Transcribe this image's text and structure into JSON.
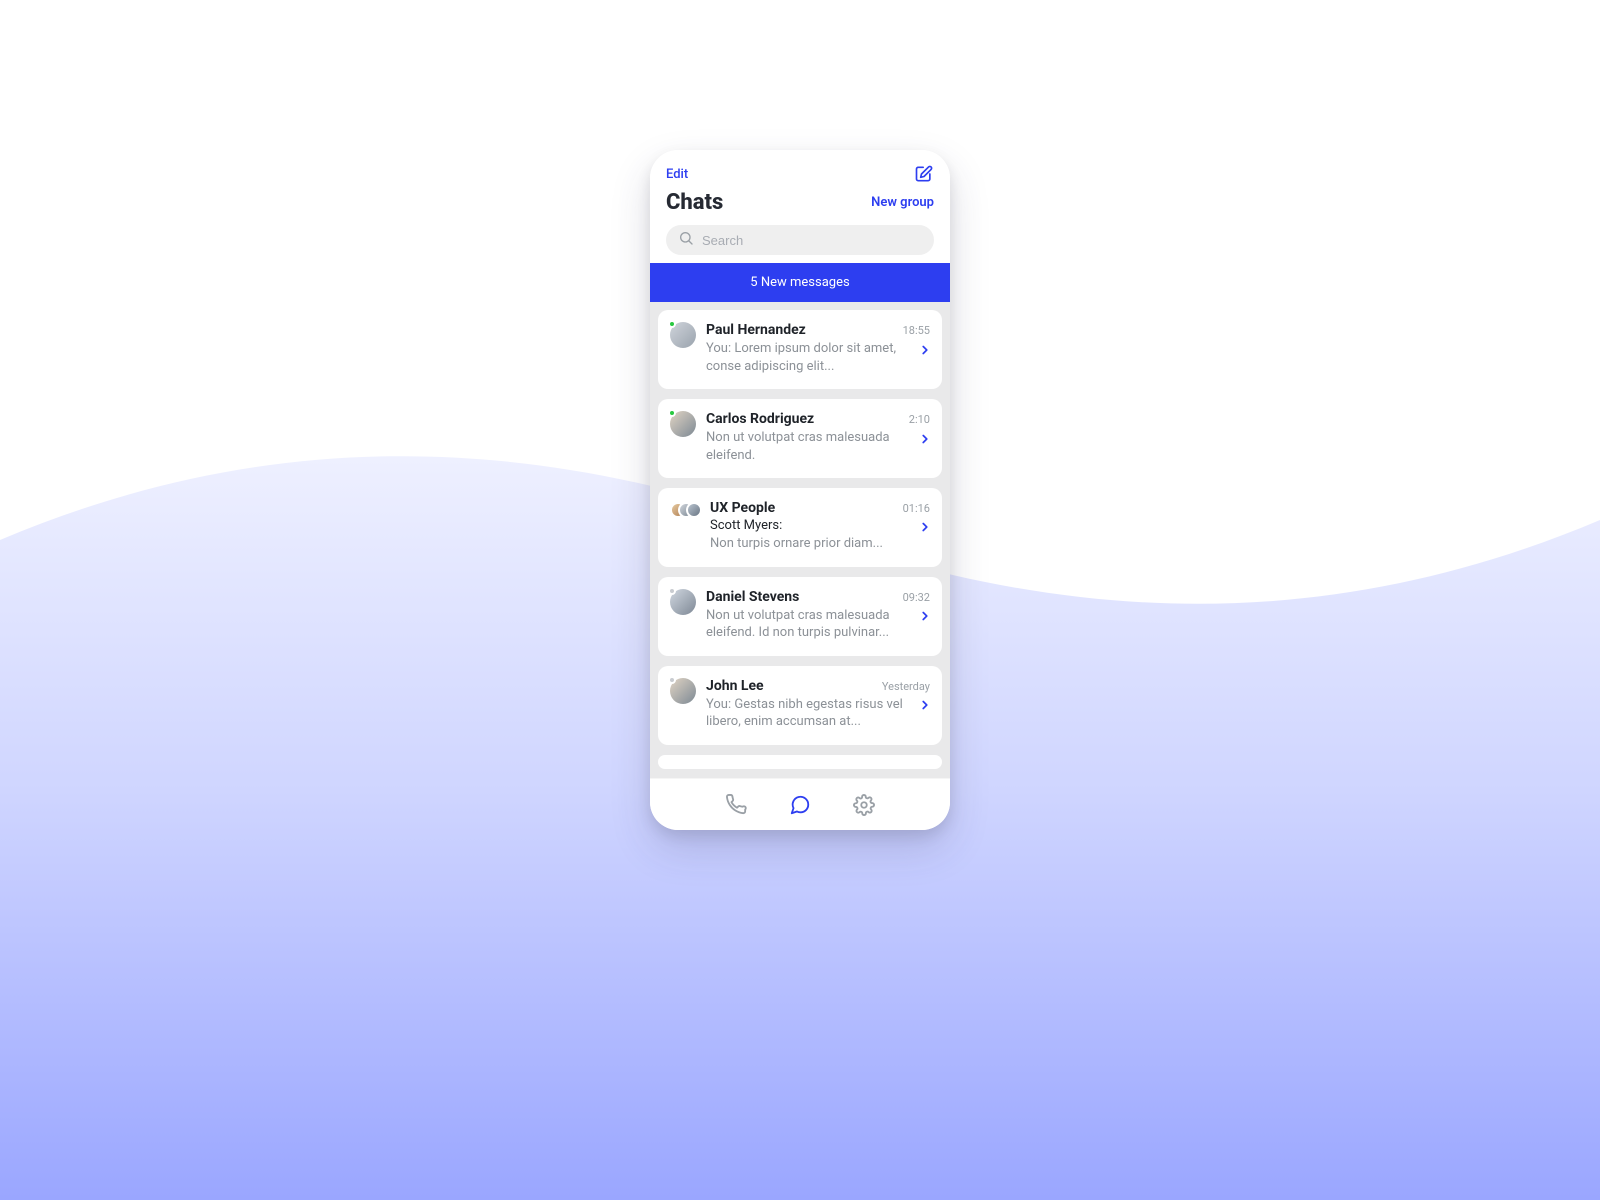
{
  "header": {
    "edit_label": "Edit",
    "title": "Chats",
    "new_group_label": "New group",
    "search_placeholder": "Search"
  },
  "banner": {
    "text": "5 New messages"
  },
  "chats": [
    {
      "name": "Paul Hernandez",
      "time": "18:55",
      "preview": "You: Lorem ipsum dolor sit amet, conse adipiscing elit...",
      "online": true
    },
    {
      "name": "Carlos Rodriguez",
      "time": "2:10",
      "preview": "Non ut volutpat cras malesuada eleifend.",
      "online": true
    },
    {
      "name": "UX People",
      "time": "01:16",
      "sender": "Scott Myers:",
      "preview": "Non turpis ornare prior diam...",
      "group": true
    },
    {
      "name": "Daniel Stevens",
      "time": "09:32",
      "preview": "Non ut volutpat cras malesuada eleifend. Id non turpis pulvinar...",
      "online": false
    },
    {
      "name": "John Lee",
      "time": "Yesterday",
      "preview": "You: Gestas nibh egestas risus vel libero, enim accumsan at...",
      "online": false
    }
  ],
  "colors": {
    "accent": "#2d3ef0"
  }
}
